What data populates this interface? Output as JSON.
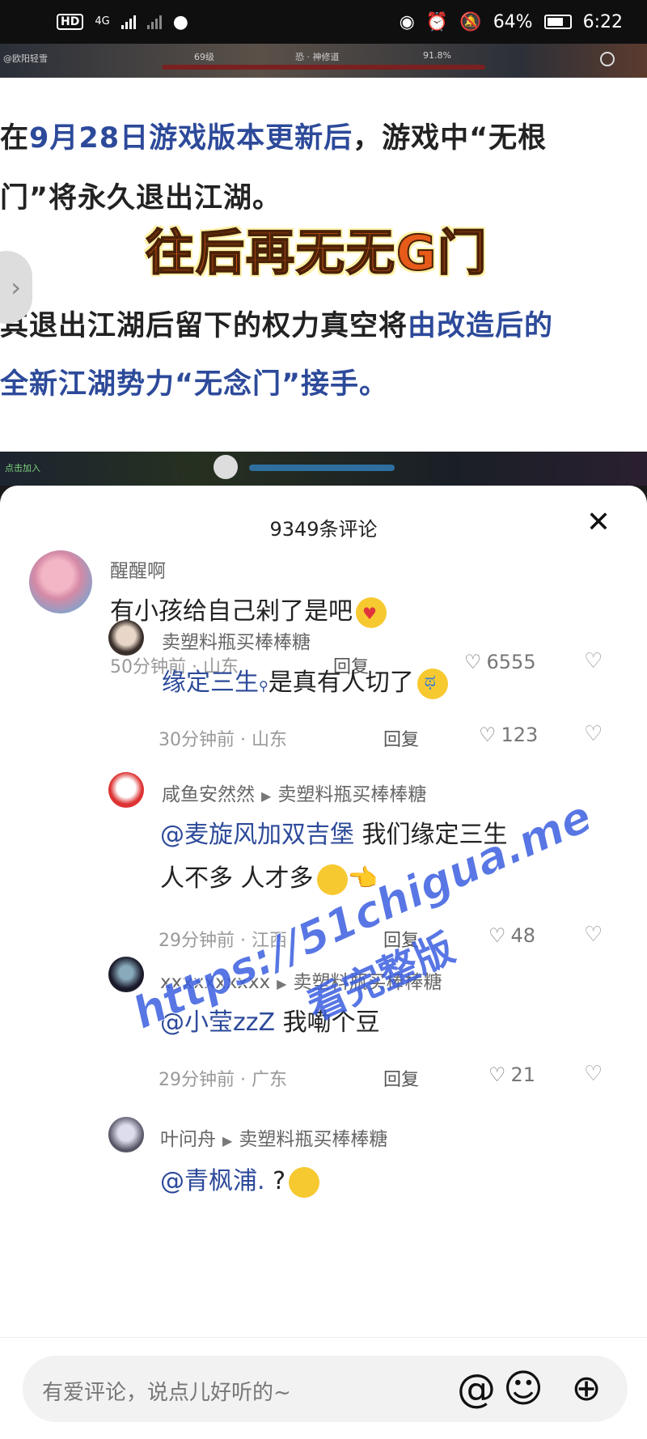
{
  "status_bar": {
    "hd": "HD",
    "network": "4G",
    "battery": "64%",
    "time": "6:22"
  },
  "video_top": {
    "left_label": "@欧阳轻雪",
    "level_a": "69级",
    "level_b": "恐 · 神修道",
    "percent": "91.8%"
  },
  "article": {
    "line1_prefix": "在",
    "line1_blue": "9月28日游戏版本更新后",
    "line1_suffix": "，游戏中“无根",
    "line2": "门”将永久退出江湖。",
    "banner": "往后再无无G门",
    "line3_prefix": "其退出江湖后留下的权力真空将",
    "line3_blue": "由改造后的",
    "line4": "全新江湖势力“无念门”接手。"
  },
  "video_bottom": {
    "left_label": "点击加入"
  },
  "sheet": {
    "title": "9349条评论",
    "close_icon": "close-icon"
  },
  "comments": [
    {
      "user": "醒醒啊",
      "text": "有小孩给自己剁了是吧",
      "time": "50分钟前",
      "location": "山东",
      "reply": "回复",
      "likes": "6555"
    },
    {
      "user": "卖塑料瓶买棒棒糖",
      "mention": "缘定三生",
      "text": "是真有人切了",
      "time": "30分钟前",
      "location": "山东",
      "reply": "回复",
      "likes": "123"
    },
    {
      "user": "咸鱼安然然",
      "reply_to": "卖塑料瓶买棒棒糖",
      "mention": "@麦旋风加双吉堡",
      "text": "我们缘定三生",
      "text2": "人不多 人才多",
      "time": "29分钟前",
      "location": "江西",
      "reply": "回复",
      "likes": "48"
    },
    {
      "user": "xxxxxxxxxx",
      "reply_to": "卖塑料瓶买棒棒糖",
      "mention": "@小莹zzZ",
      "text": "我嘞个豆",
      "time": "29分钟前",
      "location": "广东",
      "reply": "回复",
      "likes": "21"
    },
    {
      "user": "叶问舟",
      "reply_to": "卖塑料瓶买棒棒糖",
      "mention": "@青枫浦.",
      "text": "?"
    }
  ],
  "watermark": {
    "url": "https://51chigua.me",
    "text": "看完整版"
  },
  "input": {
    "placeholder": "有爱评论，说点儿好听的~",
    "icons": [
      "at-icon",
      "emoji-icon",
      "add-icon"
    ]
  }
}
